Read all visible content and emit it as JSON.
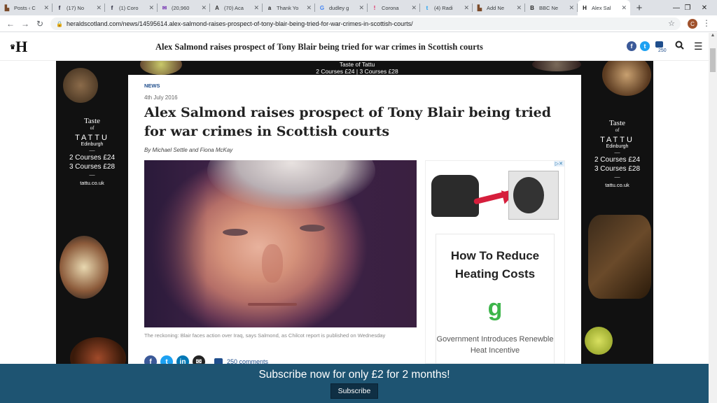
{
  "browser": {
    "tabs": [
      {
        "label": "Posts ‹ C",
        "fav": "▙",
        "favColor": "#7a4a2a"
      },
      {
        "label": "(17) No",
        "fav": "f",
        "favColor": "#1a1a2e"
      },
      {
        "label": "(1) Coro",
        "fav": "f",
        "favColor": "#1a1a2e"
      },
      {
        "label": "(20,960 ",
        "fav": "✉",
        "favColor": "#7b3fb5"
      },
      {
        "label": "(70) Aca",
        "fav": "A",
        "favColor": "#333333"
      },
      {
        "label": "Thank Yo",
        "fav": "a",
        "favColor": "#222222"
      },
      {
        "label": "dudley g",
        "fav": "G",
        "favColor": "#4285f4"
      },
      {
        "label": "Corona",
        "fav": "!",
        "favColor": "#e0245e"
      },
      {
        "label": "(4) Radi",
        "fav": "t",
        "favColor": "#1da1f2"
      },
      {
        "label": "Add Ne",
        "fav": "▙",
        "favColor": "#7a4a2a"
      },
      {
        "label": "BBC Ne",
        "fav": "B",
        "favColor": "#222222"
      },
      {
        "label": "Alex Sal",
        "fav": "H",
        "favColor": "#111111"
      }
    ],
    "new_tab": "+",
    "window_controls": {
      "minimize": "—",
      "maximize": "❐",
      "close": "✕"
    },
    "back": "←",
    "forward": "→",
    "reload": "↻",
    "url": "heraldscotland.com/news/14595614.alex-salmond-raises-prospect-of-tony-blair-being-tried-for-war-crimes-in-scottish-courts/",
    "profile_initial": "C",
    "star": "☆",
    "menu": "⋮"
  },
  "site": {
    "logo": "H",
    "header_title": "Alex Salmond raises prospect of Tony Blair being tried for war crimes in Scottish courts",
    "comment_count_small": "250",
    "search_icon": "🔍",
    "menu_icon": "☰"
  },
  "ad": {
    "top_banner": {
      "line1": "Taste of Tattu",
      "line2": "2 Courses £24 | 3 Courses £28"
    },
    "skyscraper": {
      "taste": "Taste",
      "of": "of",
      "brand": "TATTU",
      "city": "Edinburgh",
      "dash": "—",
      "price1": "2 Courses £24",
      "price2": "3 Courses £28",
      "url": "tattu.co.uk"
    }
  },
  "article": {
    "section": "NEWS",
    "date": "4th July 2016",
    "headline": "Alex Salmond raises prospect of Tony Blair being tried for war crimes in Scottish courts",
    "byline": "By Michael Settle and Fiona McKay",
    "caption": "The reckoning: Blair faces action over Iraq, says Salmond, as Chilcot report is published on Wednesday",
    "comments": "250 comments"
  },
  "side_ad": {
    "adchoices": "▷✕",
    "title": "How To Reduce Heating Costs",
    "logo_letter": "g",
    "subtitle": "Government Introduces Renewble Heat Incentive"
  },
  "subscribe": {
    "text": "Subscribe now for only £2 for 2 months!",
    "button": "Subscribe"
  },
  "colors": {
    "brand_blue": "#1f4e8c",
    "facebook": "#3b5998",
    "twitter": "#1da1f2",
    "linkedin": "#0077b5",
    "email": "#222222",
    "subscribe_bg": "#1e5472",
    "ad_green": "#3cb54a"
  }
}
